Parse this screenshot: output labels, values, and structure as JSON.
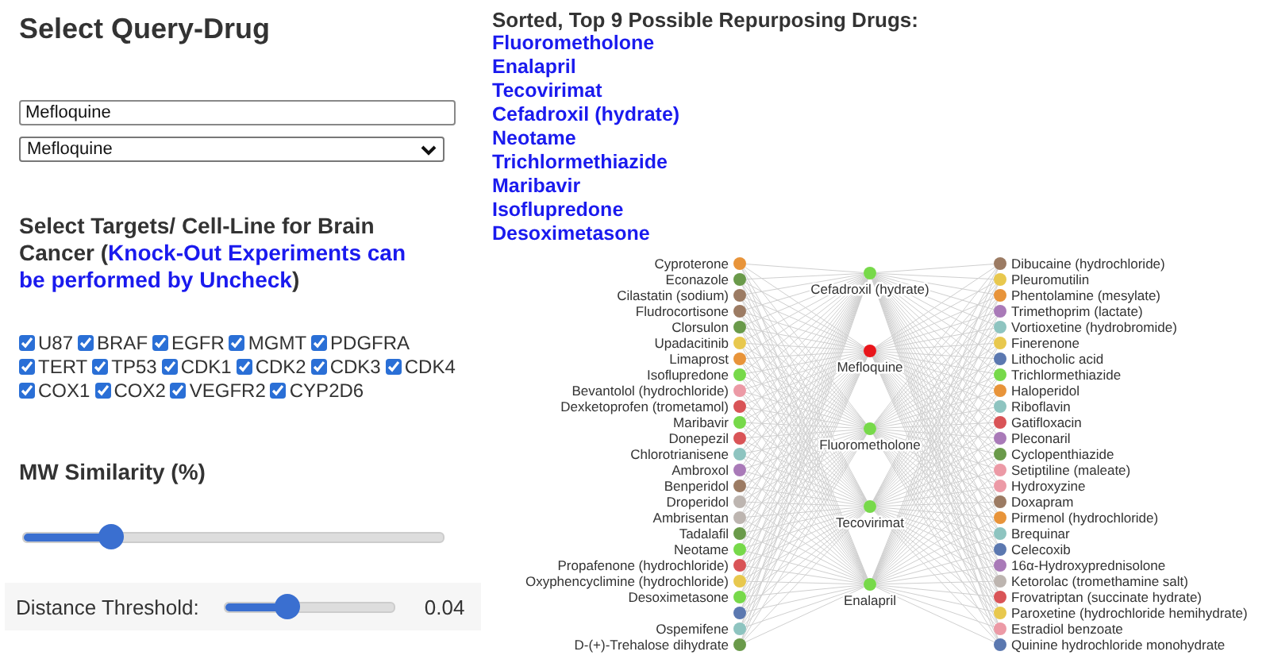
{
  "query": {
    "title": "Select Query-Drug",
    "search_value": "Mefloquine",
    "select_value": "Mefloquine"
  },
  "targets": {
    "heading_start": "Select Targets/ Cell-Line for Brain Cancer (",
    "heading_note": "Knock-Out Experiments can be performed by Uncheck",
    "heading_end": ")",
    "items": [
      {
        "label": "U87",
        "checked": true
      },
      {
        "label": "BRAF",
        "checked": true
      },
      {
        "label": "EGFR",
        "checked": true
      },
      {
        "label": "MGMT",
        "checked": true
      },
      {
        "label": "PDGFRA",
        "checked": true
      },
      {
        "label": "TERT",
        "checked": true
      },
      {
        "label": "TP53",
        "checked": true
      },
      {
        "label": "CDK1",
        "checked": true
      },
      {
        "label": "CDK2",
        "checked": true
      },
      {
        "label": "CDK3",
        "checked": true
      },
      {
        "label": "CDK4",
        "checked": true
      },
      {
        "label": "COX1",
        "checked": true
      },
      {
        "label": "COX2",
        "checked": true
      },
      {
        "label": "VEGFR2",
        "checked": true
      },
      {
        "label": "CYP2D6",
        "checked": true
      }
    ]
  },
  "mw_similarity": {
    "label": "MW Similarity (%)",
    "level": 0.21
  },
  "distance_threshold": {
    "label": "Distance Threshold:",
    "level": 0.36,
    "reading": "0.04"
  },
  "results": {
    "heading": "Sorted, Top 9 Possible Repurposing Drugs:",
    "drugs": [
      "Fluorometholone",
      "Enalapril",
      "Tecovirimat",
      "Cefadroxil (hydrate)",
      "Neotame",
      "Trichlormethiazide",
      "Maribavir",
      "Isoflupredone",
      "Desoximetasone"
    ]
  },
  "graph": {
    "nodes": [
      {
        "label": "Cefadroxil (hydrate)",
        "color": "#77d94a"
      },
      {
        "label": "Mefloquine",
        "color": "#e8151a"
      },
      {
        "label": "Cyproterone",
        "color": "#e8943a"
      },
      {
        "label": "Dibucaine (hydrochloride)",
        "color": "#9c7b63"
      },
      {
        "label": "Econazole",
        "color": "#6a9a4a"
      },
      {
        "label": "Pleuromutilin",
        "color": "#e8c84e"
      },
      {
        "label": "Cilastatin (sodium)",
        "color": "#9c7b63"
      },
      {
        "label": "Phentolamine (mesylate)",
        "color": "#e8943a"
      },
      {
        "label": "Fludrocortisone",
        "color": "#9c7b63"
      },
      {
        "label": "Trimethoprim (lactate)",
        "color": "#a97ab8"
      },
      {
        "label": "Clorsulon",
        "color": "#6a9a4a"
      },
      {
        "label": "Vortioxetine (hydrobromide)",
        "color": "#8ec4c0"
      },
      {
        "label": "Upadacitinib",
        "color": "#e8c84e"
      },
      {
        "label": "Finerenone",
        "color": "#e8c84e"
      },
      {
        "label": "Limaprost",
        "color": "#e8943a"
      },
      {
        "label": "Lithocholic acid",
        "color": "#5b78b0"
      },
      {
        "label": "Isoflupredone",
        "color": "#77d94a"
      },
      {
        "label": "Trichlormethiazide",
        "color": "#77d94a"
      },
      {
        "label": "Bevantolol (hydrochloride)",
        "color": "#ec9aa6"
      },
      {
        "label": "Haloperidol",
        "color": "#e8943a"
      },
      {
        "label": "Dexketoprofen (trometamol)",
        "color": "#d95457"
      },
      {
        "label": "Riboflavin",
        "color": "#8ec4c0"
      },
      {
        "label": "Maribavir",
        "color": "#77d94a"
      },
      {
        "label": "Gatifloxacin",
        "color": "#d95457"
      },
      {
        "label": "Donepezil",
        "color": "#d95457"
      },
      {
        "label": "Pleconaril",
        "color": "#a97ab8"
      },
      {
        "label": "Chlorotrianisene",
        "color": "#8ec4c0"
      },
      {
        "label": "Cyclopenthiazide",
        "color": "#6a9a4a"
      },
      {
        "label": "Ambroxol",
        "color": "#a97ab8"
      },
      {
        "label": "Setiptiline (maleate)",
        "color": "#ec9aa6"
      },
      {
        "label": "Benperidol",
        "color": "#9c7b63"
      },
      {
        "label": "Hydroxyzine",
        "color": "#ec9aa6"
      },
      {
        "label": "Droperidol",
        "color": "#bdb5b0"
      },
      {
        "label": "Doxapram",
        "color": "#9c7b63"
      },
      {
        "label": "Ambrisentan",
        "color": "#bdb5b0"
      },
      {
        "label": "Pirmenol (hydrochloride)",
        "color": "#e8943a"
      },
      {
        "label": "Tadalafil",
        "color": "#6a9a4a"
      },
      {
        "label": "Brequinar",
        "color": "#8ec4c0"
      },
      {
        "label": "Neotame",
        "color": "#77d94a"
      },
      {
        "label": "Celecoxib",
        "color": "#5b78b0"
      },
      {
        "label": "Propafenone (hydrochloride)",
        "color": "#d95457"
      },
      {
        "label": "16α-Hydroxyprednisolone",
        "color": "#a97ab8"
      },
      {
        "label": "Oxyphencyclimine (hydrochloride)",
        "color": "#e8c84e"
      },
      {
        "label": "Ketorolac (tromethamine salt)",
        "color": "#bdb5b0"
      },
      {
        "label": "Desoximetasone",
        "color": "#77d94a"
      },
      {
        "label": "Frovatriptan (succinate hydrate)",
        "color": "#d95457"
      },
      {
        "label": "Fluorometholone",
        "color": "#77d94a"
      },
      {
        "color": "#5b78b0"
      },
      {
        "label": "Paroxetine (hydrochloride hemihydrate)",
        "color": "#e8c84e"
      },
      {
        "label": "Tecovirimat",
        "color": "#77d94a"
      },
      {
        "label": "Ospemifene",
        "color": "#8ec4c0"
      },
      {
        "label": "Enalapril",
        "color": "#77d94a"
      },
      {
        "label": "Estradiol benzoate",
        "color": "#ec9aa6"
      },
      {
        "label": "D-(+)-Trehalose dihydrate",
        "color": "#6a9a4a"
      },
      {
        "label": "Quinine hydrochloride monohydrate",
        "color": "#5b78b0"
      }
    ]
  }
}
